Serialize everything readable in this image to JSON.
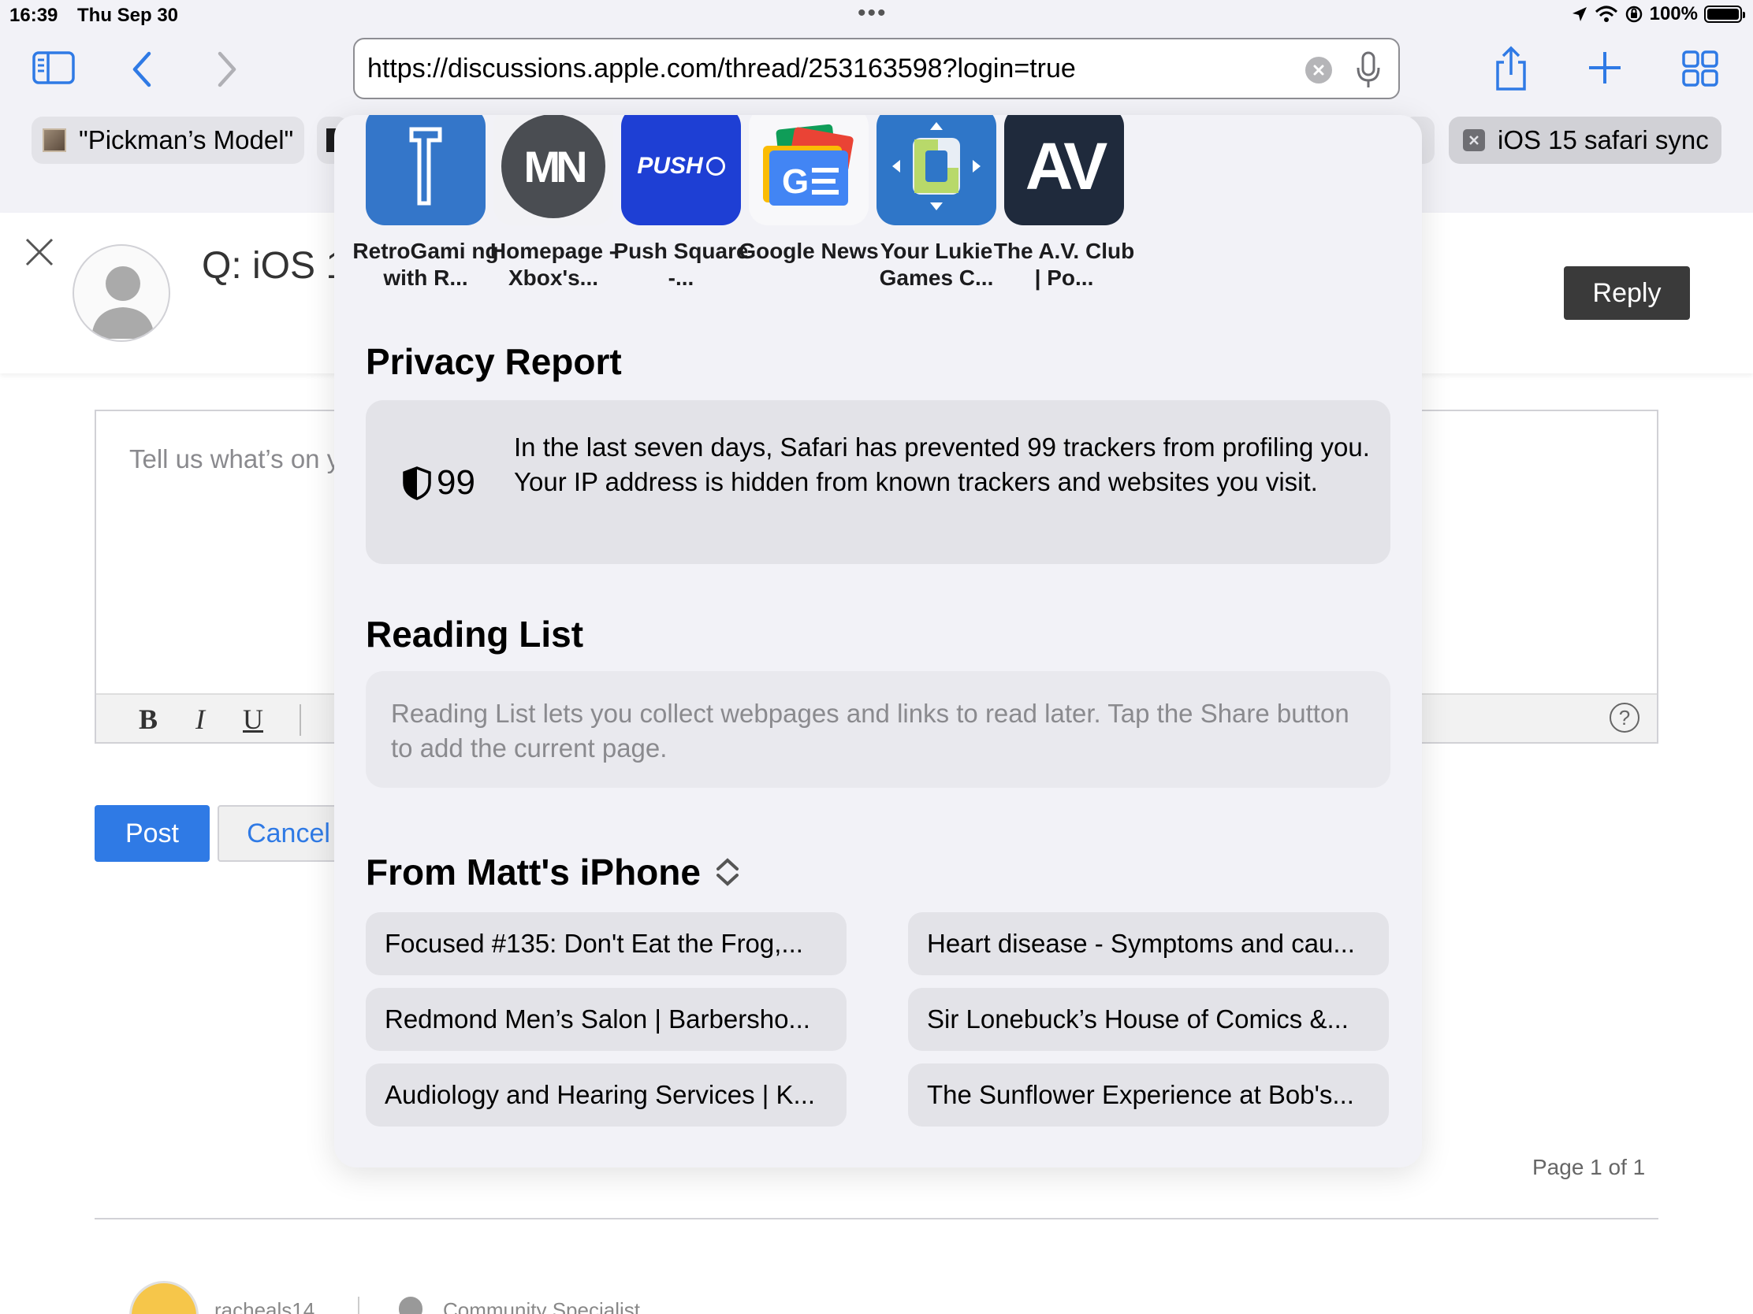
{
  "status_bar": {
    "time": "16:39",
    "date": "Thu Sep 30",
    "battery": "100%"
  },
  "address_bar": {
    "url": "https://discussions.apple.com/thread/253163598?login=true"
  },
  "tabs": [
    {
      "label": "\"Pickman’s Model\""
    },
    {
      "label": "iOS 15 safari sync"
    }
  ],
  "page": {
    "question_title": "Q: iOS 1",
    "reply_label": "Reply",
    "editor_placeholder": "Tell us what’s on y",
    "bold": "B",
    "italic": "I",
    "underline": "U",
    "help": "?",
    "post_label": "Post",
    "cancel_label": "Cancel",
    "page_count": "Page 1 of 1",
    "bottom_user": "racheals14",
    "bottom_role": "Community Specialist"
  },
  "favorites": [
    {
      "label": "RetroGami ng with R...",
      "icon": "retrogaming-icon",
      "color": "#3476c9"
    },
    {
      "label": "Homepage - Xbox's...",
      "icon": "mn-icon",
      "color": "#f2f2f5",
      "glyph": "MN"
    },
    {
      "label": "Push Square -...",
      "icon": "push-square-icon",
      "color": "#1e3fd4",
      "glyph": "PUSH"
    },
    {
      "label": "Google News",
      "icon": "google-news-icon",
      "color": "#f8f8fa"
    },
    {
      "label": "Your Lukie Games C...",
      "icon": "lukie-games-icon",
      "color": "#2f76c8"
    },
    {
      "label": "The A.V. Club | Po...",
      "icon": "av-club-icon",
      "color": "#1f2a3c",
      "glyph": "AV"
    }
  ],
  "privacy_report": {
    "title": "Privacy Report",
    "count": "99",
    "text": "In the last seven days, Safari has prevented 99 trackers from profiling you. Your IP address is hidden from known trackers and websites you visit."
  },
  "reading_list": {
    "title": "Reading List",
    "text": "Reading List lets you collect webpages and links to read later. Tap the Share button to add the current page."
  },
  "from_device": {
    "title": "From Matt's iPhone",
    "tabs": [
      "Focused #135: Don't Eat the Frog,...",
      "Heart disease - Symptoms and cau...",
      "Redmond Men’s Salon | Barbersho...",
      "Sir Lonebuck’s House of Comics &...",
      "Audiology and Hearing Services | K...",
      "The Sunflower Experience at Bob's..."
    ]
  }
}
